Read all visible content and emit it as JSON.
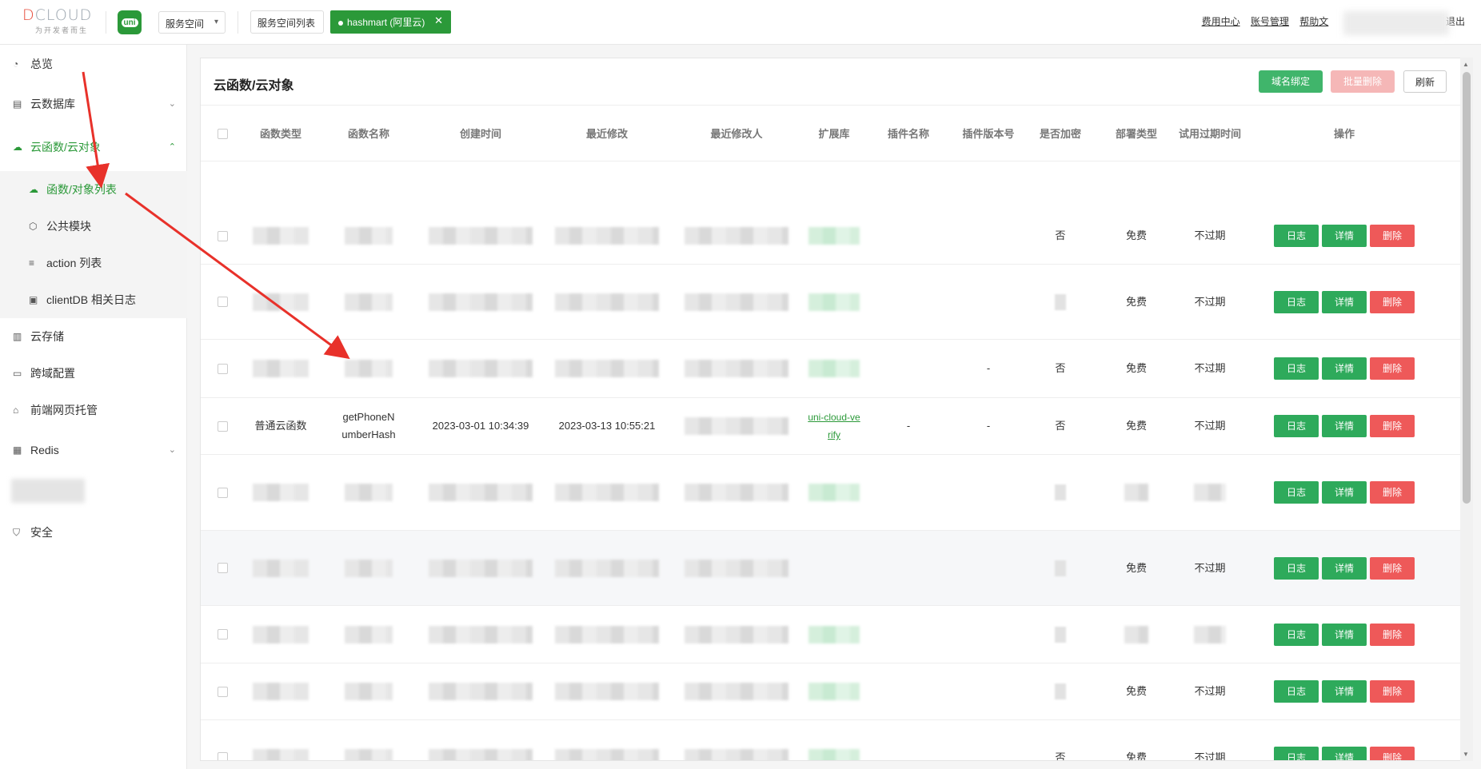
{
  "header": {
    "brand": "DCLOUD",
    "slogan": "为开发者而生",
    "uni_logo": "uni",
    "space_select": "服务空间",
    "space_list_button": "服务空间列表",
    "active_space_tab": "hashmart (阿里云)",
    "links": [
      "费用中心",
      "账号管理",
      "帮助文"
    ],
    "logout": "退出"
  },
  "sidebar": {
    "items": [
      {
        "label": "总览",
        "icon": "pie-chart-icon"
      },
      {
        "label": "云数据库",
        "icon": "database-icon"
      },
      {
        "label": "云函数/云对象",
        "icon": "cloud-icon"
      },
      {
        "label": "云存储",
        "icon": "storage-icon"
      },
      {
        "label": "跨域配置",
        "icon": "cross-domain-icon"
      },
      {
        "label": "前端网页托管",
        "icon": "hosting-icon"
      },
      {
        "label": "Redis",
        "icon": "redis-icon"
      },
      {
        "label": "安全",
        "icon": "shield-icon"
      }
    ],
    "subitems": [
      {
        "label": "函数/对象列表",
        "icon": "cloud-icon"
      },
      {
        "label": "公共模块",
        "icon": "cube-icon"
      },
      {
        "label": "action 列表",
        "icon": "list-icon"
      },
      {
        "label": "clientDB 相关日志",
        "icon": "log-icon"
      }
    ]
  },
  "panel": {
    "title": "云函数/云对象",
    "buttons": {
      "domain": "域名绑定",
      "batch_delete": "批量删除",
      "refresh": "刷新"
    }
  },
  "table": {
    "headers": [
      "函数类型",
      "函数名称",
      "创建时间",
      "最近修改",
      "最近修改人",
      "扩展库",
      "插件名称",
      "插件版本号",
      "是否加密",
      "部署类型",
      "试用过期时间",
      "操作"
    ],
    "ops": {
      "log": "日志",
      "detail": "详情",
      "delete": "删除"
    },
    "visible_row": {
      "type": "普通云函数",
      "name": "getPhoneNumberHash",
      "created": "2023-03-01 10:34:39",
      "modified": "2023-03-13 10:55:21",
      "ext": "uni-cloud-verify",
      "plugin_name": "-",
      "plugin_version": "-",
      "encrypted": "否",
      "deploy": "免费",
      "expire": "不过期"
    },
    "rows": [
      {
        "encrypted": "否",
        "deploy": "免费",
        "expire": "不过期"
      },
      {
        "encrypted": "",
        "deploy": "免费",
        "expire": "不过期"
      },
      {
        "encrypted": "否",
        "deploy": "免费",
        "expire": "不过期",
        "plugin_version": "-"
      },
      {},
      {
        "encrypted": "",
        "deploy": "",
        "expire": ""
      },
      {
        "encrypted": "",
        "deploy": "免费",
        "expire": "不过期"
      },
      {
        "encrypted": "",
        "deploy": "",
        "expire": ""
      },
      {
        "encrypted": "",
        "deploy": "免费",
        "expire": "不过期"
      },
      {
        "encrypted": "否",
        "deploy": "免费",
        "expire": "不过期"
      }
    ]
  },
  "colors": {
    "primary": "#2b9939",
    "button_green": "#2eaa5b",
    "danger": "#ee5959",
    "arrow": "#e8312a"
  }
}
